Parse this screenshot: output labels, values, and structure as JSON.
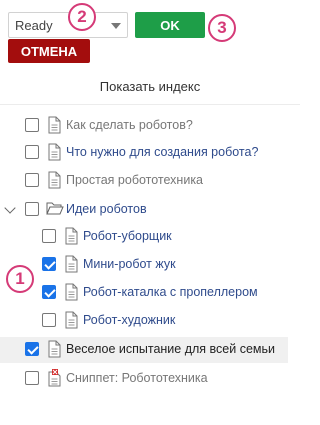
{
  "toolbar": {
    "status_select": "Ready",
    "ok_label": "OK",
    "cancel_label": "ОТМЕНА"
  },
  "callouts": {
    "one": "1",
    "two": "2",
    "three": "3"
  },
  "panel": {
    "title": "Показать индекс"
  },
  "tree": [
    {
      "label": "Как сделать роботов?",
      "style": "gray",
      "checked": false,
      "icon": "document-icon"
    },
    {
      "label": "Что нужно для создания робота?",
      "style": "link",
      "checked": false,
      "icon": "document-icon"
    },
    {
      "label": "Простая робототехника",
      "style": "gray",
      "checked": false,
      "icon": "document-icon"
    },
    {
      "label": "Идеи роботов",
      "style": "link",
      "checked": false,
      "icon": "folder-open-icon",
      "expanded": true
    },
    {
      "label": "Робот-уборщик",
      "style": "link",
      "checked": false,
      "icon": "document-icon"
    },
    {
      "label": "Мини-робот жук",
      "style": "link",
      "checked": true,
      "icon": "document-icon"
    },
    {
      "label": "Робот-каталка с пропеллером",
      "style": "link",
      "checked": true,
      "icon": "document-icon"
    },
    {
      "label": "Робот-художник",
      "style": "link",
      "checked": false,
      "icon": "document-icon"
    },
    {
      "label": "Веселое испытание для всей семьи",
      "style": "dark",
      "checked": true,
      "icon": "document-icon",
      "highlight": true
    },
    {
      "label": "Сниппет: Робототехника",
      "style": "gray",
      "checked": false,
      "icon": "snippet-error-icon"
    }
  ],
  "colors": {
    "ok": "#1e9e48",
    "cancel": "#a30d0d",
    "callout": "#d53a77",
    "checkbox": "#1a73e8"
  }
}
